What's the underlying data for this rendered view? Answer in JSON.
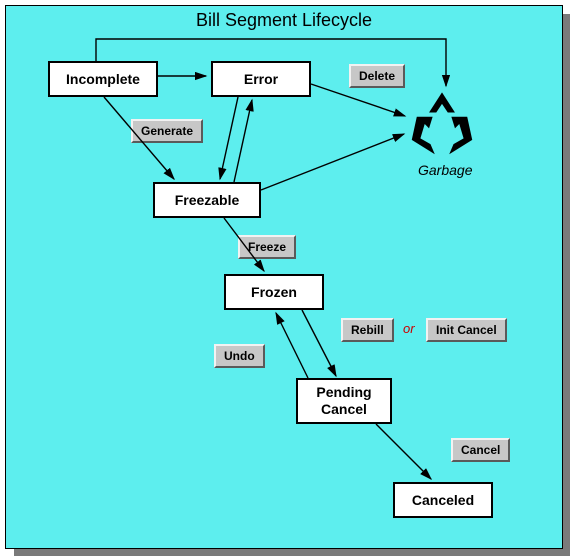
{
  "title": "Bill Segment Lifecycle",
  "states": {
    "incomplete": "Incomplete",
    "error": "Error",
    "freezable": "Freezable",
    "frozen": "Frozen",
    "pending_cancel": "Pending Cancel",
    "canceled": "Canceled"
  },
  "buttons": {
    "delete": "Delete",
    "generate": "Generate",
    "freeze": "Freeze",
    "rebill": "Rebill",
    "init_cancel": "Init Cancel",
    "undo": "Undo",
    "cancel": "Cancel"
  },
  "labels": {
    "or": "or",
    "garbage": "Garbage"
  },
  "transitions": [
    {
      "from": "incomplete",
      "to": "error"
    },
    {
      "from": "incomplete",
      "to": "freezable",
      "via": "generate"
    },
    {
      "from": "incomplete",
      "to": "garbage"
    },
    {
      "from": "error",
      "to": "freezable"
    },
    {
      "from": "error",
      "to": "garbage",
      "via": "delete"
    },
    {
      "from": "freezable",
      "to": "error"
    },
    {
      "from": "freezable",
      "to": "frozen",
      "via": "freeze"
    },
    {
      "from": "freezable",
      "to": "garbage"
    },
    {
      "from": "frozen",
      "to": "pending_cancel",
      "via": "rebill/init_cancel"
    },
    {
      "from": "pending_cancel",
      "to": "frozen",
      "via": "undo"
    },
    {
      "from": "pending_cancel",
      "to": "canceled",
      "via": "cancel"
    }
  ]
}
